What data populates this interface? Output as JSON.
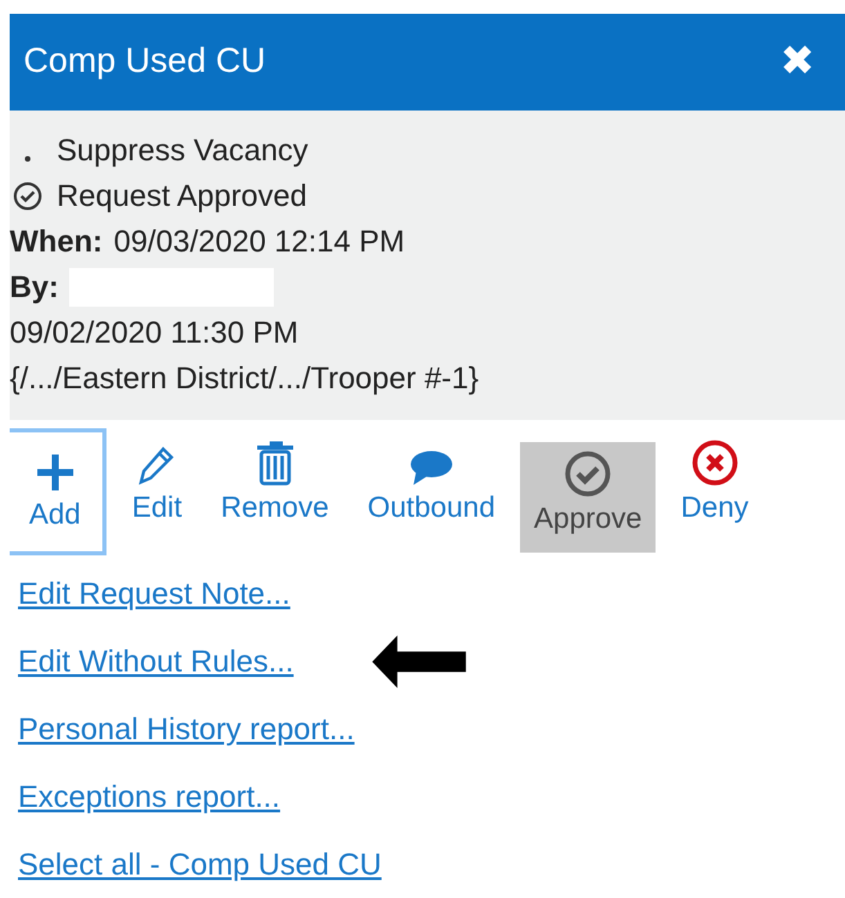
{
  "window": {
    "title": "Comp Used CU",
    "close": "✖"
  },
  "details": {
    "lines": [
      {
        "kind": "dot",
        "text": "Suppress Vacancy"
      },
      {
        "kind": "check",
        "text": "Request Approved"
      },
      {
        "kind": "labeled",
        "label": "When:",
        "text": "09/03/2020 12:14 PM"
      },
      {
        "kind": "redacted",
        "label": "By:"
      },
      {
        "kind": "plain",
        "text": "09/02/2020 11:30 PM"
      },
      {
        "kind": "plain",
        "text": "{/.../Eastern District/.../Trooper #-1}"
      }
    ]
  },
  "toolbar": [
    {
      "kind": "add",
      "label": "Add",
      "focused": true,
      "selected": false
    },
    {
      "kind": "edit",
      "label": "Edit",
      "focused": false,
      "selected": false
    },
    {
      "kind": "remove",
      "label": "Remove",
      "focused": false,
      "selected": false
    },
    {
      "kind": "outbound",
      "label": "Outbound",
      "focused": false,
      "selected": false
    },
    {
      "kind": "approve",
      "label": "Approve",
      "focused": false,
      "selected": true
    },
    {
      "kind": "deny",
      "label": "Deny",
      "focused": false,
      "selected": false
    }
  ],
  "links": [
    {
      "text": "Edit Request Note..."
    },
    {
      "text": "Edit Without Rules...",
      "pointer_arrow": true
    },
    {
      "text": "Personal History report..."
    },
    {
      "text": "Exceptions report..."
    },
    {
      "text": "Select all - Comp Used CU"
    }
  ]
}
